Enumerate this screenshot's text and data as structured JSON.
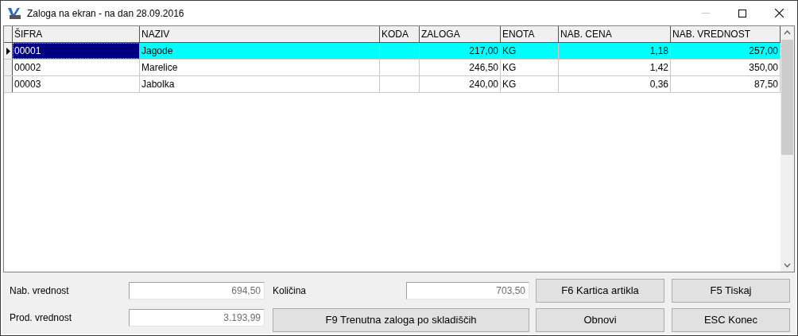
{
  "window": {
    "title": "Zaloga na ekran - na dan 28.09.2016"
  },
  "table": {
    "columns": [
      {
        "label": "ŠIFRA",
        "kind": "text"
      },
      {
        "label": "NAZIV",
        "kind": "text"
      },
      {
        "label": "KODA",
        "kind": "text"
      },
      {
        "label": "ZALOGA",
        "kind": "number"
      },
      {
        "label": "ENOTA",
        "kind": "text"
      },
      {
        "label": "NAB. CENA",
        "kind": "number"
      },
      {
        "label": "NAB. VREDNOST",
        "kind": "number"
      }
    ],
    "rows": [
      {
        "selected": true,
        "cells": [
          "00001",
          "Jagode",
          "",
          "217,00",
          "KG",
          "1,18",
          "257,00"
        ]
      },
      {
        "selected": false,
        "cells": [
          "00002",
          "Marelice",
          "",
          "246,50",
          "KG",
          "1,42",
          "350,00"
        ]
      },
      {
        "selected": false,
        "cells": [
          "00003",
          "Jabolka",
          "",
          "240,00",
          "KG",
          "0,36",
          "87,50"
        ]
      }
    ]
  },
  "summary": {
    "nab_vrednost": {
      "label": "Nab. vrednost",
      "value": "694,50"
    },
    "prod_vrednost": {
      "label": "Prod. vrednost",
      "value": "3.193,99"
    },
    "kolicina": {
      "label": "Količina",
      "value": "703,50"
    }
  },
  "buttons": {
    "stock_by_warehouse": "F9 Trenutna zaloga po skladiščih",
    "item_card": "F6 Kartica artikla",
    "refresh": "Obnovi",
    "print": "F5 Tiskaj",
    "exit": "ESC Konec"
  }
}
